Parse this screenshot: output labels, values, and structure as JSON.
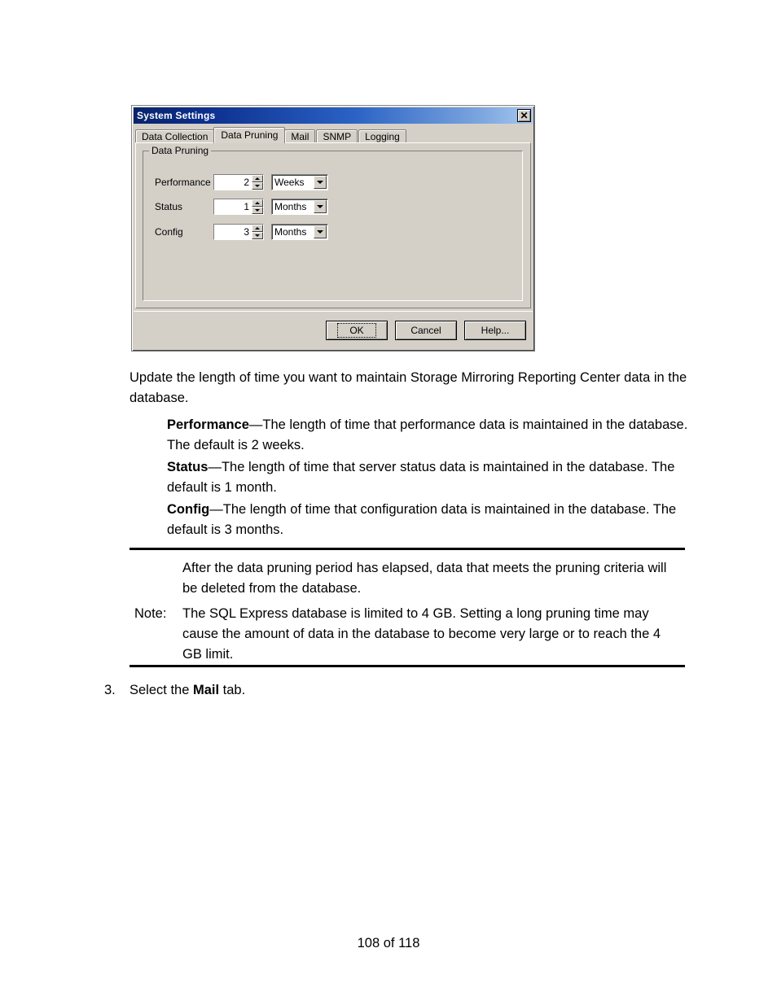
{
  "dialog": {
    "title": "System Settings",
    "close_icon": "close-icon",
    "tabs": [
      {
        "label": "Data Collection",
        "active": false
      },
      {
        "label": "Data Pruning",
        "active": true
      },
      {
        "label": "Mail",
        "active": false
      },
      {
        "label": "SNMP",
        "active": false
      },
      {
        "label": "Logging",
        "active": false
      }
    ],
    "group_label": "Data Pruning",
    "fields": [
      {
        "label": "Performance",
        "value": "2",
        "unit": "Weeks"
      },
      {
        "label": "Status",
        "value": "1",
        "unit": "Months"
      },
      {
        "label": "Config",
        "value": "3",
        "unit": "Months"
      }
    ],
    "buttons": {
      "ok": "OK",
      "cancel": "Cancel",
      "help": "Help..."
    },
    "colors": {
      "titlebar_start": "#0a246a",
      "titlebar_end": "#a6c8f0",
      "face": "#d4d0c8"
    }
  },
  "document": {
    "intro": "Update the length of time you want to maintain Storage Mirroring Reporting Center data in the database.",
    "items": [
      {
        "term": "Performance",
        "description": "—The length of time that performance data is maintained in the database. The default is 2 weeks."
      },
      {
        "term": "Status",
        "description": "—The length of time that server status data is maintained in the database. The default is 1 month."
      },
      {
        "term": "Config",
        "description": "—The length of time that configuration data is maintained in the database. The default is 3 months."
      }
    ],
    "note": {
      "label": "Note:",
      "paragraph1": "After the data pruning period has elapsed, data that meets the pruning criteria will be deleted from the database.",
      "paragraph2": "The SQL Express database is limited to 4 GB. Setting a long pruning time may cause the amount of data in the database to become very large or to reach the 4 GB limit."
    },
    "step": {
      "number": "3.",
      "text_before": "Select the ",
      "bold": "Mail",
      "text_after": " tab."
    },
    "footer": "108 of 118"
  }
}
